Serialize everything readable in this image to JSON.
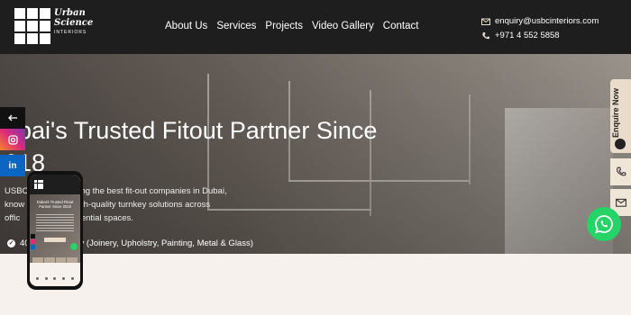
{
  "header": {
    "logo": {
      "line1": "Urban",
      "line2": "Science",
      "line3": "INTERIORS"
    },
    "nav": [
      "About Us",
      "Services",
      "Projects",
      "Video Gallery",
      "Contact"
    ],
    "email": "enquiry@usbcinteriors.com",
    "phone": "+971 4 552 5858",
    "email_icon": "mail-icon",
    "phone_icon": "phone-icon"
  },
  "hero": {
    "title_line1": "ubai's Trusted Fitout Partner Since",
    "title_line2": "018",
    "desc_line1": "USBC                    ong the best fit-out companies in Dubai,",
    "desc_line2": "know                    high-quality turnkey solutions across",
    "desc_line3": "offic                   esidential spaces.",
    "feature": "40                  ory (Joinery, Upholstry, Painting, Metal & Glass)"
  },
  "side": {
    "enquire_label": "Enquire Now",
    "phone_icon": "phone-icon",
    "mail_icon": "mail-icon",
    "whatsapp_icon": "whatsapp-icon"
  },
  "social": {
    "back_icon": "arrow-left-icon",
    "instagram_icon": "instagram-icon",
    "linkedin_label": "in"
  },
  "phone_preview": {
    "title": "Dubai's Trusted Fitout Partner Since 2018"
  },
  "colors": {
    "header_bg": "#1e1e1e",
    "accent": "#e9dccb",
    "whatsapp": "#25d366",
    "instagram": "#c13584",
    "linkedin": "#0a66c2"
  }
}
